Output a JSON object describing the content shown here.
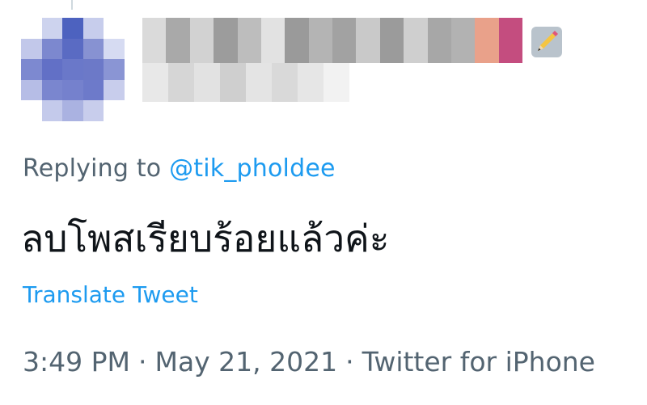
{
  "tweet": {
    "replying_prefix": "Replying to ",
    "replying_to": "@tik_pholdee",
    "text": "ลบโพสเรียบร้อยแล้วค่ะ",
    "translate_label": "Translate Tweet",
    "time": "3:49 PM",
    "separator": "·",
    "date": "May 21, 2021",
    "source": "Twitter for iPhone"
  },
  "author": {
    "avatar_icon": "blurred-avatar",
    "badge_icon": "pencil-emoji-icon"
  },
  "colors": {
    "link": "#1d9bf0",
    "secondary_text": "#536471",
    "primary_text": "#0f1419"
  }
}
